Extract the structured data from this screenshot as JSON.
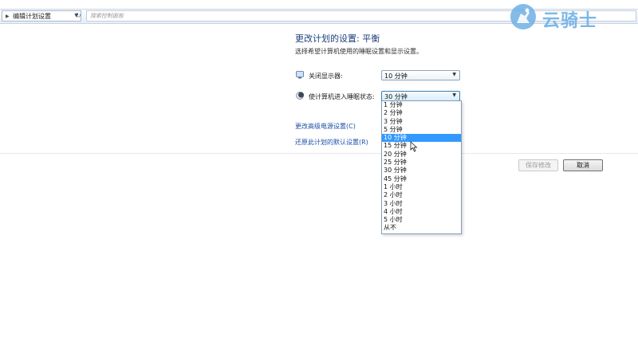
{
  "address_bar": {
    "breadcrumb": "编辑计划设置",
    "search_placeholder": "搜索控制面板"
  },
  "logo": {
    "text": "云骑士"
  },
  "main": {
    "title": "更改计划的设置: 平衡",
    "subtitle": "选择希望计算机使用的睡眠设置和显示设置。",
    "display_off": {
      "label": "关闭显示器:",
      "value": "10 分钟"
    },
    "sleep": {
      "label": "使计算机进入睡眠状态:",
      "value": "30 分钟"
    },
    "links": {
      "advanced": "更改高级电源设置(C)",
      "restore": "还原此计划的默认设置(R)"
    },
    "buttons": {
      "save": "保存修改",
      "cancel": "取消"
    }
  },
  "dropdown": {
    "selected_index": 4,
    "options": [
      "1 分钟",
      "2 分钟",
      "3 分钟",
      "5 分钟",
      "10 分钟",
      "15 分钟",
      "20 分钟",
      "25 分钟",
      "30 分钟",
      "45 分钟",
      "1 小时",
      "2 小时",
      "3 小时",
      "4 小时",
      "5 小时",
      "从不"
    ]
  },
  "colors": {
    "highlight": "#3399ff",
    "link": "#1f4fa6",
    "title": "#1e3e7a",
    "logo": "#6fb0e5"
  },
  "icons": {
    "display": "monitor-icon",
    "sleep": "moon-icon",
    "logo": "knight-logo-icon"
  }
}
